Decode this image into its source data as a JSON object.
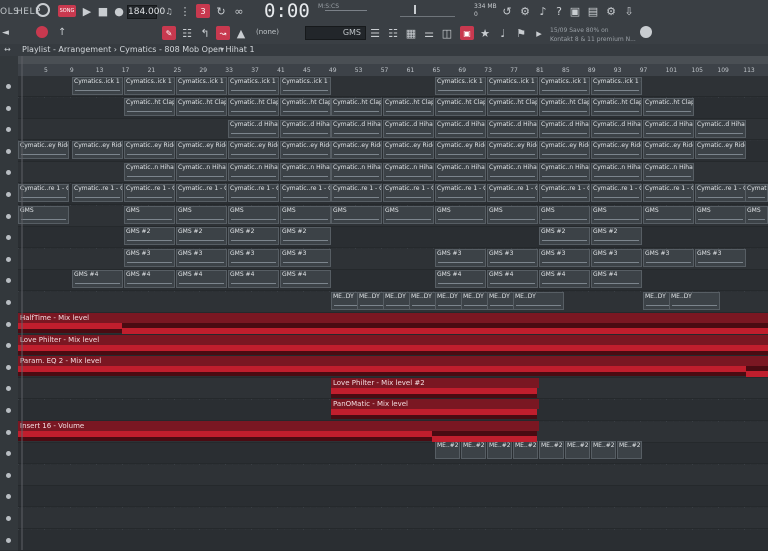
{
  "menu": {
    "tools_label": "OLS",
    "help_label": "HELP",
    "pat_label": "PAT",
    "song_label": "SONG"
  },
  "transport": {
    "tempo": "184.000",
    "time": "0:00",
    "time_small": ":00",
    "time_mini": "M:S:CS"
  },
  "cpu": {
    "memory": "334 MB",
    "polyphony": "0"
  },
  "toolbar2": {
    "none_label": "(none)",
    "snap_label": "GMS"
  },
  "promo": {
    "line1": "15/09  Save 80% on",
    "line2": "Kontakt 8 & 11 premium N..."
  },
  "titlebar": {
    "text": "Playlist - Arrangement › Cymatics - 808 Mob Open Hihat 1"
  },
  "ruler": {
    "bars": [
      "5",
      "9",
      "13",
      "17",
      "21",
      "25",
      "29",
      "33",
      "37",
      "41",
      "45",
      "49",
      "53",
      "57",
      "61",
      "65",
      "69",
      "73",
      "77",
      "81",
      "85",
      "89",
      "93",
      "97",
      "101",
      "105",
      "109",
      "113"
    ]
  },
  "tracks": [
    {
      "clip_label": "Cymatics..ick 1 - C",
      "clip_label_alt": "Cymatics..ick 1 - C"
    },
    {
      "clip_label": "Cymatic..ht Clap 4"
    },
    {
      "clip_label": "Cymatic..d Hihat 3"
    },
    {
      "clip_label": "Cymatic..ey Ride 5",
      "clip_label_alt": "Cymat..y Ride 5"
    },
    {
      "clip_label": "Cymatic..n Hihat 2"
    },
    {
      "clip_label": "Cymatic..re 1 - C#",
      "clip_label_alt": "Cymati..1 - C#"
    },
    {
      "clip_label": "GMS"
    },
    {
      "clip_label": "GMS #2"
    },
    {
      "clip_label": "GMS #3"
    },
    {
      "clip_label": "GMS #4"
    },
    {
      "clip_label": "ME..DY"
    }
  ],
  "automation": [
    {
      "label": "HalfTime - Mix level"
    },
    {
      "label": "Love Philter - Mix level"
    },
    {
      "label": "Param. EQ 2 - Mix level"
    },
    {
      "label": "Love Philter - Mix level #2"
    },
    {
      "label": "PanOMatic - Mix level"
    },
    {
      "label": "Insert 16 - Volume"
    }
  ],
  "last_track": {
    "clip_label": "ME..#2"
  },
  "colors": {
    "accent": "#ff3d5f",
    "automation": "#c01e2d",
    "background": "#2c3034"
  }
}
